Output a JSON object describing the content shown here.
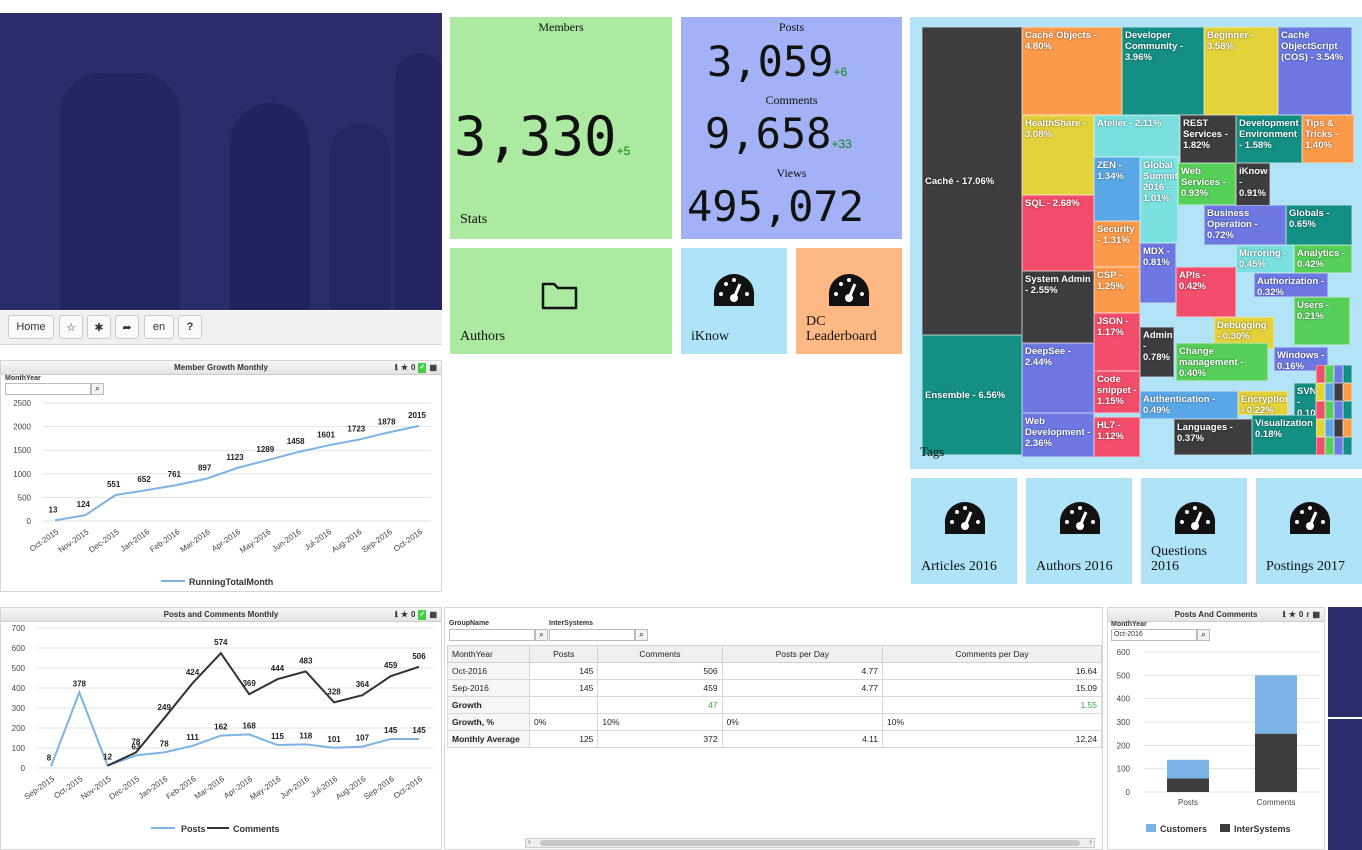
{
  "nav": {
    "home_label": "Home",
    "lang_label": "en",
    "help_label": "?"
  },
  "member_growth": {
    "title": "Member Growth Monthly",
    "filter_label": "MonthYear",
    "legend": "RunningTotalMonth",
    "line_color": "#7bb3e6"
  },
  "posts_comments_monthly": {
    "title": "Posts and Comments Monthly",
    "legend_posts": "Posts",
    "legend_comments": "Comments",
    "posts_color": "#7bb3e6",
    "comments_color": "#333333"
  },
  "stats": {
    "members_title": "Members",
    "members_value": "3,330",
    "members_delta": "+5",
    "stats_label": "Stats",
    "posts_title": "Posts",
    "posts_value": "3,059",
    "posts_delta": "+6",
    "comments_title": "Comments",
    "comments_value": "9,658",
    "comments_delta": "+33",
    "views_title": "Views",
    "views_value": "495,072"
  },
  "tiles": {
    "authors": "Authors",
    "iknow": "iKnow",
    "dc_leaderboard_line1": "DC",
    "dc_leaderboard_line2": "Leaderboard",
    "articles_2016": "Articles 2016",
    "authors_2016": "Authors 2016",
    "questions_2016_line1": "Questions",
    "questions_2016_line2": "2016",
    "postings_2017": "Postings 2017",
    "green": "#abeaa0",
    "blue": "#a3b2f6",
    "lightblue": "#aee3f8",
    "orange": "#fdb883"
  },
  "treemap": {
    "label": "Tags",
    "cells": [
      {
        "label": "Caché - 17.06%",
        "color": "#3d3d40"
      },
      {
        "label": "Ensemble - 6.56%",
        "color": "#148f84"
      },
      {
        "label": "Caché Objects - 4.80%",
        "color": "#fb9a4a"
      },
      {
        "label": "Developer Community - 3.96%",
        "color": "#148f84"
      },
      {
        "label": "Beginner - 3.58%",
        "color": "#e3d23a"
      },
      {
        "label": "Caché ObjectScript (COS) - 3.54%",
        "color": "#6d78e2"
      },
      {
        "label": "HealthShare - 3.08%",
        "color": "#e3d23a"
      },
      {
        "label": "Atelier - 2.11%",
        "color": "#7be0e0"
      },
      {
        "label": "REST Services - 1.82%",
        "color": "#3d3d40"
      },
      {
        "label": "Development Environment - 1.58%",
        "color": "#148f84"
      },
      {
        "label": "Tips & Tricks - 1.40%",
        "color": "#fb9a4a"
      },
      {
        "label": "SQL - 2.68%",
        "color": "#f24d6a"
      },
      {
        "label": "ZEN - 1.34%",
        "color": "#59a7e6"
      },
      {
        "label": "Global Summit 2016 - 1.01%",
        "color": "#7be0e0"
      },
      {
        "label": "Web Services - 0.93%",
        "color": "#57d05a"
      },
      {
        "label": "iKnow - 0.91%",
        "color": "#3d3d40"
      },
      {
        "label": "Security - 1.31%",
        "color": "#fb9a4a"
      },
      {
        "label": "Business Operation - 0.72%",
        "color": "#6d78e2"
      },
      {
        "label": "Globals - 0.65%",
        "color": "#148f84"
      },
      {
        "label": "System Admin - 2.55%",
        "color": "#3d3d40"
      },
      {
        "label": "CSP - 1.25%",
        "color": "#fb9a4a"
      },
      {
        "label": "MDX - 0.81%",
        "color": "#6d78e2"
      },
      {
        "label": "Mirroring - 0.45%",
        "color": "#7be0e0"
      },
      {
        "label": "Analytics - 0.42%",
        "color": "#57d05a"
      },
      {
        "label": "APIs - 0.42%",
        "color": "#f24d6a"
      },
      {
        "label": "Authorization - 0.32%",
        "color": "#6d78e2"
      },
      {
        "label": "DeepSee - 2.44%",
        "color": "#6d78e2"
      },
      {
        "label": "JSON - 1.17%",
        "color": "#f24d6a"
      },
      {
        "label": "Admin - 0.78%",
        "color": "#3d3d40"
      },
      {
        "label": "Debugging - 0.30%",
        "color": "#e3d23a"
      },
      {
        "label": "Users - 0.21%",
        "color": "#57d05a"
      },
      {
        "label": "Code snippet - 1.15%",
        "color": "#f24d6a"
      },
      {
        "label": "Change management - 0.40%",
        "color": "#57d05a"
      },
      {
        "label": "Windows - 0.16%",
        "color": "#6d78e2"
      },
      {
        "label": "Web Development - 2.36%",
        "color": "#6d78e2"
      },
      {
        "label": "Authentication - 0.49%",
        "color": "#59a7e6"
      },
      {
        "label": "Encryption - 0.22%",
        "color": "#e3d23a"
      },
      {
        "label": "SVN - 0.10%",
        "color": "#148f84"
      },
      {
        "label": "HL7 - 1.12%",
        "color": "#f24d6a"
      },
      {
        "label": "Languages - 0.37%",
        "color": "#3d3d40"
      },
      {
        "label": "Visualization - 0.18%",
        "color": "#148f84"
      }
    ]
  },
  "table_widget": {
    "filter1_label": "GroupName",
    "filter2_label": "InterSystems",
    "columns": [
      "MonthYear",
      "Posts",
      "Comments",
      "Posts per Day",
      "Comments per Day"
    ],
    "rows": [
      {
        "label": "Oct-2016",
        "cells": [
          "145",
          "506",
          "4.77",
          "16.64"
        ]
      },
      {
        "label": "Sep-2016",
        "cells": [
          "145",
          "459",
          "4.77",
          "15.09"
        ]
      },
      {
        "label": "Growth",
        "cells": [
          "",
          "47",
          "",
          "1.55"
        ]
      },
      {
        "label": "Growth, %",
        "cells": [
          "0%",
          "10%",
          "0%",
          "10%"
        ]
      },
      {
        "label": "Monthly Average",
        "cells": [
          "125",
          "372",
          "4.11",
          "12.24"
        ]
      }
    ],
    "growth_color": "#3aa83a"
  },
  "posts_and_comments": {
    "title": "Posts And Comments",
    "filter_label": "MonthYear",
    "filter_value": "Oct-2016",
    "legend_customers": "Customers",
    "legend_intersystems": "InterSystems",
    "customers_color": "#7bb3e6",
    "intersystems_color": "#3d3d40"
  },
  "chart_data": [
    {
      "type": "line",
      "title": "Member Growth Monthly",
      "x": [
        "Oct-2015",
        "Nov-2015",
        "Dec-2015",
        "Jan-2016",
        "Feb-2016",
        "Mar-2016",
        "Apr-2016",
        "May-2016",
        "Jun-2016",
        "Jul-2016",
        "Aug-2016",
        "Sep-2016",
        "Oct-2016"
      ],
      "series": [
        {
          "name": "RunningTotalMonth",
          "values": [
            13,
            124,
            551,
            652,
            761,
            897,
            1123,
            1289,
            1458,
            1601,
            1723,
            1878,
            2015
          ]
        }
      ],
      "yticks": [
        0,
        500,
        1000,
        1500,
        2000,
        2500
      ],
      "ylim": [
        0,
        2500
      ],
      "legend": "bottom"
    },
    {
      "type": "line",
      "title": "Posts and Comments Monthly",
      "x": [
        "Sep-2015",
        "Oct-2015",
        "Nov-2015",
        "Dec-2015",
        "Jan-2016",
        "Feb-2016",
        "Mar-2016",
        "Apr-2016",
        "May-2016",
        "Jun-2016",
        "Jul-2016",
        "Aug-2016",
        "Sep-2016",
        "Oct-2016"
      ],
      "series": [
        {
          "name": "Posts",
          "values": [
            8,
            378,
            12,
            63,
            78,
            111,
            162,
            168,
            115,
            118,
            101,
            107,
            145,
            145
          ]
        },
        {
          "name": "Comments",
          "values": [
            null,
            null,
            12,
            78,
            249,
            424,
            574,
            369,
            444,
            483,
            328,
            364,
            459,
            506
          ]
        }
      ],
      "yticks": [
        0,
        100,
        200,
        300,
        400,
        500,
        600,
        700
      ],
      "ylim": [
        0,
        700
      ],
      "legend": "bottom"
    },
    {
      "type": "bar",
      "title": "Posts And Comments",
      "categories": [
        "Posts",
        "Comments"
      ],
      "series": [
        {
          "name": "InterSystems",
          "values": [
            58,
            250
          ]
        },
        {
          "name": "Customers",
          "values": [
            80,
            250
          ]
        }
      ],
      "stacked": true,
      "yticks": [
        0,
        100,
        200,
        300,
        400,
        500,
        600
      ],
      "ylim": [
        0,
        600
      ],
      "legend": "bottom"
    }
  ]
}
